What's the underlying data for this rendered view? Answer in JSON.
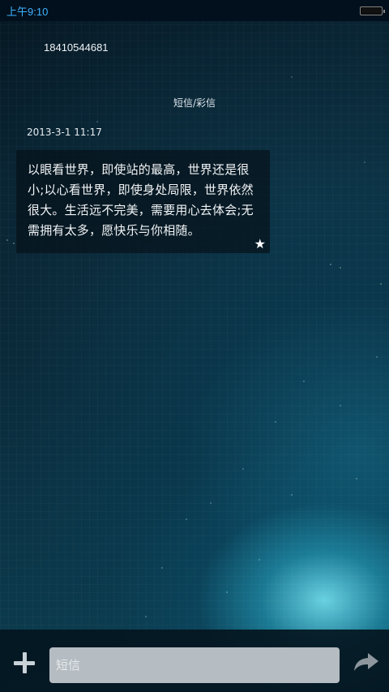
{
  "status_bar": {
    "time": "上午9:10"
  },
  "conversation": {
    "contact_number": "18410544681",
    "message_type": "短信/彩信",
    "messages": [
      {
        "timestamp": "2013-3-1 11:17",
        "text": "以眼看世界，即使站的最高，世界还是很小;以心看世界，即使身处局限，世界依然很大。生活远不完美，需要用心去体会;无需拥有太多，愿快乐与你相随。",
        "starred_icon": "star-icon"
      }
    ]
  },
  "compose": {
    "placeholder": "短信",
    "add_icon": "plus-icon",
    "send_icon": "send-arrow-icon"
  }
}
